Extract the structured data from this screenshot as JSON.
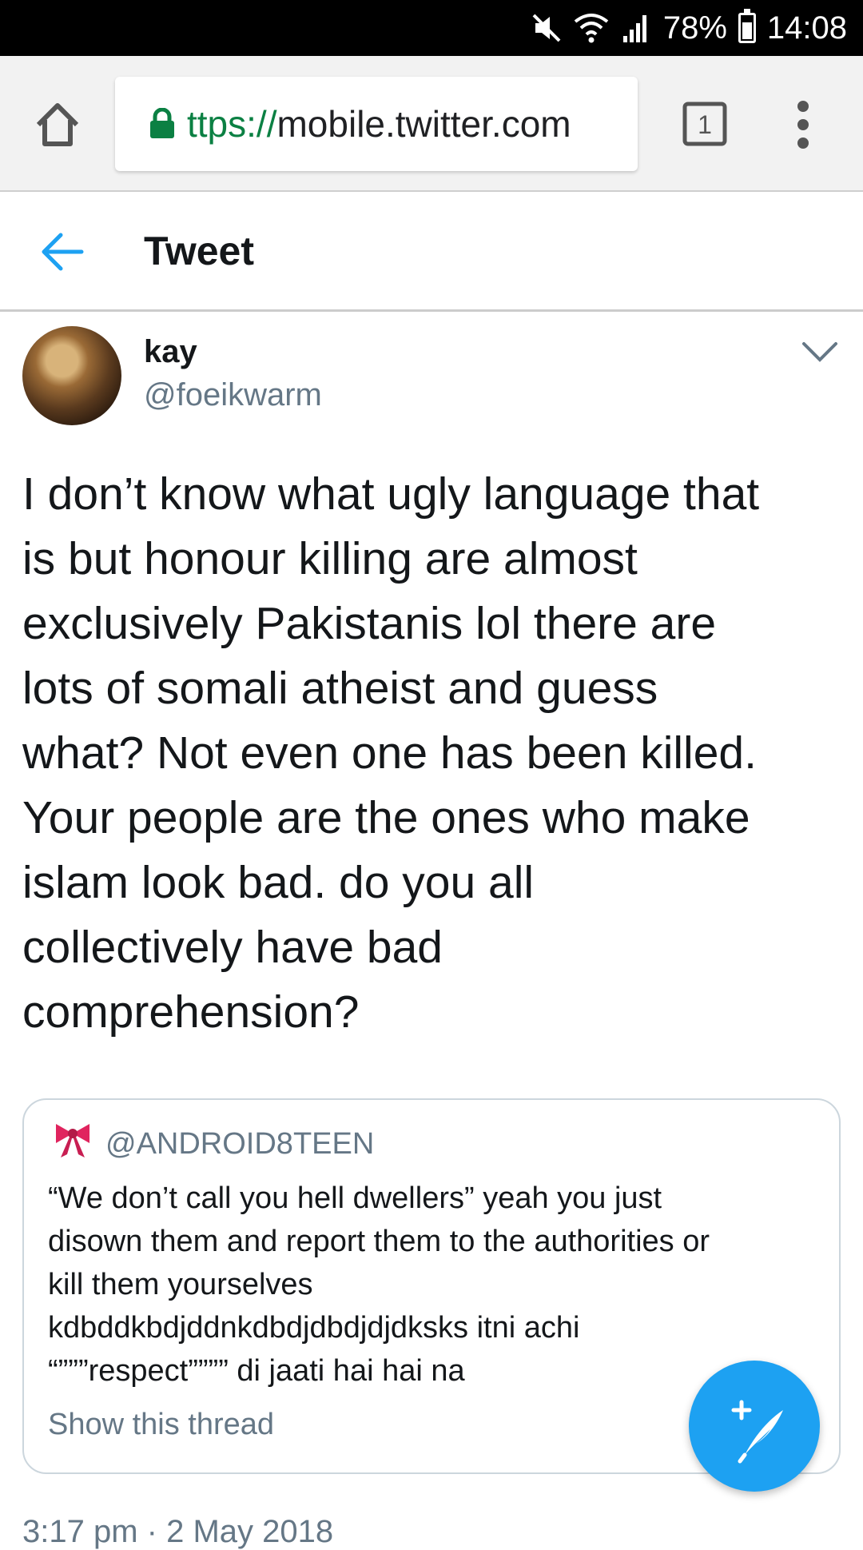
{
  "status_bar": {
    "battery": "78%",
    "time": "14:08",
    "battery_level": 0.78,
    "icons": [
      "mute-icon",
      "wifi-icon",
      "signal-icon",
      "battery-icon"
    ]
  },
  "browser": {
    "url_scheme": "ttps://",
    "url_host": "mobile.twitter.com",
    "tab_count": "1",
    "icons": [
      "home-icon",
      "lock-icon",
      "tabs-icon",
      "overflow-menu-icon"
    ]
  },
  "header": {
    "title": "Tweet",
    "back_icon": "back-arrow-icon"
  },
  "tweet": {
    "display_name": "kay",
    "handle": "@foeikwarm",
    "text": "I don’t know what ugly language that\nis but honour killing are almost\nexclusively Pakistanis lol there are\nlots of somali atheist and guess\nwhat? Not even one has been killed.\nYour people are the ones who make\nislam look bad. do you all\ncollectively have bad\ncomprehension?",
    "timestamp": "3:17 pm · 2 May 2018"
  },
  "quoted_tweet": {
    "handle": "@ANDROID8TEEN",
    "text": "“We don’t call you hell dwellers” yeah you just\ndisown them and report them to the authorities or\nkill them yourselves\nkdbddkbdjddnkdbdjdbdjdjdksks itni achi\n“”””respect”””” di jaati hai hai na",
    "show_thread": "Show this thread",
    "icon": "ribbon-bow-icon"
  },
  "colors": {
    "accent": "#1da1f2",
    "secure_green": "#0b8043",
    "secondary_text": "#657786",
    "bow_red": "#e0245e"
  }
}
